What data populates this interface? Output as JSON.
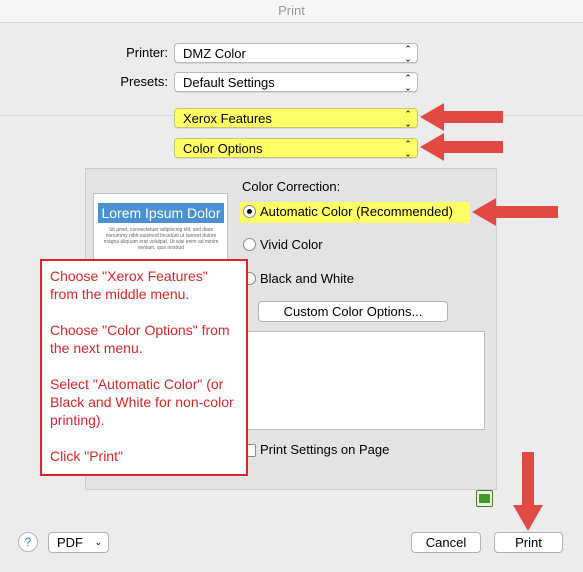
{
  "window": {
    "title": "Print"
  },
  "printer": {
    "label": "Printer:",
    "value": "DMZ Color"
  },
  "presets": {
    "label": "Presets:",
    "value": "Default Settings"
  },
  "section_menu": {
    "value": "Xerox Features"
  },
  "subsection_menu": {
    "value": "Color Options"
  },
  "preview": {
    "heading": "Lorem Ipsum Dolor",
    "body": "Sit amet, consectetuer adipiscing elit, sed diam nonummy nibh euismod tincidunt ut laoreet dolore magna aliquam erat volutpat. Ut wisi enim ad minim veniam, quis nostrud"
  },
  "color_correction": {
    "label": "Color Correction:",
    "options": [
      {
        "label": "Automatic Color (Recommended)",
        "selected": true
      },
      {
        "label": "Vivid Color",
        "selected": false
      },
      {
        "label": "Black and White",
        "selected": false
      }
    ],
    "custom_button": "Custom Color Options..."
  },
  "print_settings_on_page": {
    "label": "Print Settings on Page",
    "checked": false
  },
  "footer": {
    "help": "?",
    "pdf": "PDF",
    "cancel": "Cancel",
    "print": "Print"
  },
  "annotation": {
    "lines": [
      "Choose \"Xerox Features\" from the middle menu.",
      "Choose \"Color Options\" from the next menu.",
      "Select \"Automatic Color\" (or Black and White for non-color printing).",
      "Click \"Print\""
    ]
  },
  "colors": {
    "highlight": "#ffff66",
    "arrow": "#e14a43",
    "annotation_text": "#d8262b",
    "preview_header": "#4a90d2"
  },
  "icons": [
    "up-down-chevron-icon",
    "radio-icon",
    "checkbox-icon",
    "help-icon",
    "green-status-icon",
    "red-arrow-icon"
  ]
}
